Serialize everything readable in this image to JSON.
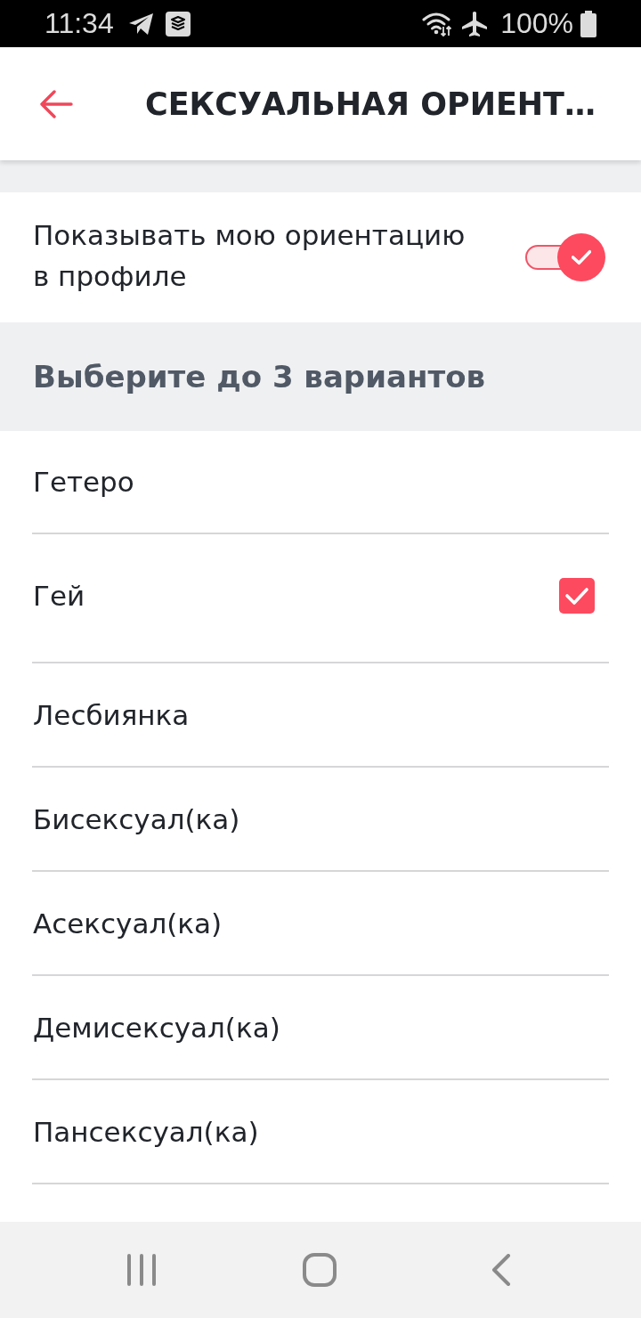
{
  "status_bar": {
    "time": "11:34",
    "battery": "100%"
  },
  "app_bar": {
    "title": "СЕКСУАЛЬНАЯ ОРИЕНТ…"
  },
  "visibility_setting": {
    "label": "Показывать мою ориентацию в профиле",
    "on": true
  },
  "section_header": "Выберите до 3 вариантов",
  "options": [
    {
      "label": "Гетеро",
      "selected": false
    },
    {
      "label": "Гей",
      "selected": true
    },
    {
      "label": "Лесбиянка",
      "selected": false
    },
    {
      "label": "Бисексуал(ка)",
      "selected": false
    },
    {
      "label": "Асексуал(ка)",
      "selected": false
    },
    {
      "label": "Демисексуал(ка)",
      "selected": false
    },
    {
      "label": "Пансексуал(ка)",
      "selected": false
    }
  ]
}
